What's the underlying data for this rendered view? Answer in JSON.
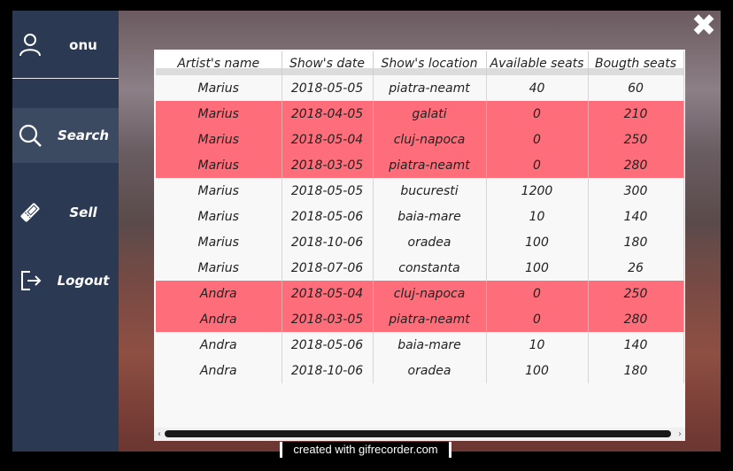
{
  "user": {
    "name": "onu",
    "icon": "user-icon"
  },
  "nav": [
    {
      "label": "Search",
      "icon": "search-icon",
      "active": true
    },
    {
      "label": "Sell",
      "icon": "ticket-icon",
      "active": false
    },
    {
      "label": "Logout",
      "icon": "logout-icon",
      "active": false
    }
  ],
  "close_icon": "close-icon",
  "colors": {
    "sidebar": "#2b3a52",
    "sidebar_active": "#3b4a61",
    "soldout_row": "#fe6e7a"
  },
  "table": {
    "headers": [
      "Artist's name",
      "Show's date",
      "Show's location",
      "Available seats",
      "Bougth seats"
    ],
    "rows": [
      {
        "cells": [
          "Marius",
          "2018-05-05",
          "piatra-neamt",
          "40",
          "60"
        ],
        "soldout": false
      },
      {
        "cells": [
          "Marius",
          "2018-04-05",
          "galati",
          "0",
          "210"
        ],
        "soldout": true
      },
      {
        "cells": [
          "Marius",
          "2018-05-04",
          "cluj-napoca",
          "0",
          "250"
        ],
        "soldout": true
      },
      {
        "cells": [
          "Marius",
          "2018-03-05",
          "piatra-neamt",
          "0",
          "280"
        ],
        "soldout": true
      },
      {
        "cells": [
          "Marius",
          "2018-05-05",
          "bucuresti",
          "1200",
          "300"
        ],
        "soldout": false
      },
      {
        "cells": [
          "Marius",
          "2018-05-06",
          "baia-mare",
          "10",
          "140"
        ],
        "soldout": false
      },
      {
        "cells": [
          "Marius",
          "2018-10-06",
          "oradea",
          "100",
          "180"
        ],
        "soldout": false
      },
      {
        "cells": [
          "Marius",
          "2018-07-06",
          "constanta",
          "100",
          "26"
        ],
        "soldout": false
      },
      {
        "cells": [
          "Andra",
          "2018-05-04",
          "cluj-napoca",
          "0",
          "250"
        ],
        "soldout": true
      },
      {
        "cells": [
          "Andra",
          "2018-03-05",
          "piatra-neamt",
          "0",
          "280"
        ],
        "soldout": true
      },
      {
        "cells": [
          "Andra",
          "2018-05-06",
          "baia-mare",
          "10",
          "140"
        ],
        "soldout": false
      },
      {
        "cells": [
          "Andra",
          "2018-10-06",
          "oradea",
          "100",
          "180"
        ],
        "soldout": false
      }
    ]
  },
  "watermark": "created with gifrecorder.com"
}
